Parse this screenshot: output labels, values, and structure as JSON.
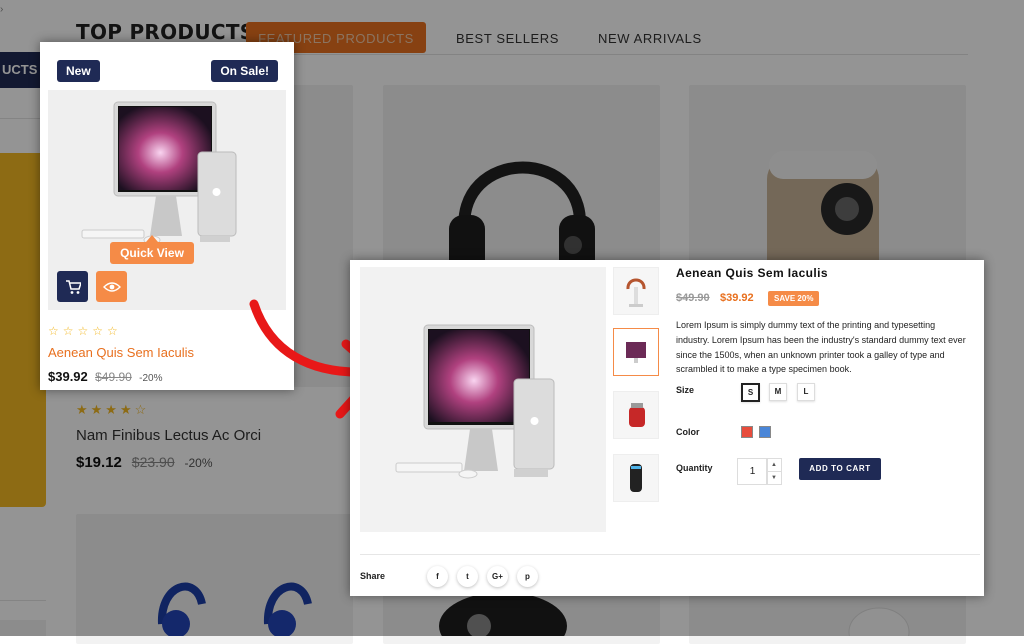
{
  "section": {
    "title": "TOP PRODUCTS",
    "tabs": [
      "FEATURED PRODUCTS",
      "BEST SELLERS",
      "NEW ARRIVALS"
    ],
    "left_pill": "UCTS"
  },
  "background_product": {
    "rating": 4,
    "name": "Nam Finibus Lectus Ac Orci",
    "price": "$19.12",
    "old_price": "$23.90",
    "discount": "-20%"
  },
  "card": {
    "badge_new": "New",
    "badge_sale": "On Sale!",
    "quick_view": "Quick View",
    "rating": 0,
    "name": "Aenean Quis Sem Iaculis",
    "price": "$39.92",
    "old_price": "$49.90",
    "discount": "-20%",
    "icons": [
      "cart-icon",
      "eye-icon"
    ]
  },
  "popup": {
    "title": "Aenean Quis Sem Iaculis",
    "old_price": "$49.90",
    "price": "$39.92",
    "save_badge": "SAVE 20%",
    "description": "Lorem Ipsum is simply dummy text of the printing and typesetting industry. Lorem Ipsum has been the industry's standard dummy text ever since the 1500s, when an unknown printer took a galley of type and scrambled it to make a type specimen book.",
    "size_label": "Size",
    "sizes": [
      "S",
      "M",
      "L"
    ],
    "selected_size": "S",
    "color_label": "Color",
    "colors": [
      "#e74c3c",
      "#4a86d8"
    ],
    "quantity_label": "Quantity",
    "quantity": "1",
    "add_to_cart": "ADD TO CART",
    "share_label": "Share",
    "social": [
      "f",
      "t",
      "G+",
      "p"
    ],
    "thumbnails": [
      "headphone-stand-thumb",
      "imac-thumb",
      "kettle-thumb",
      "speaker-thumb"
    ]
  },
  "colors": {
    "accent": "#e8701f",
    "navy": "#1f2a55",
    "star": "#f3b824"
  }
}
